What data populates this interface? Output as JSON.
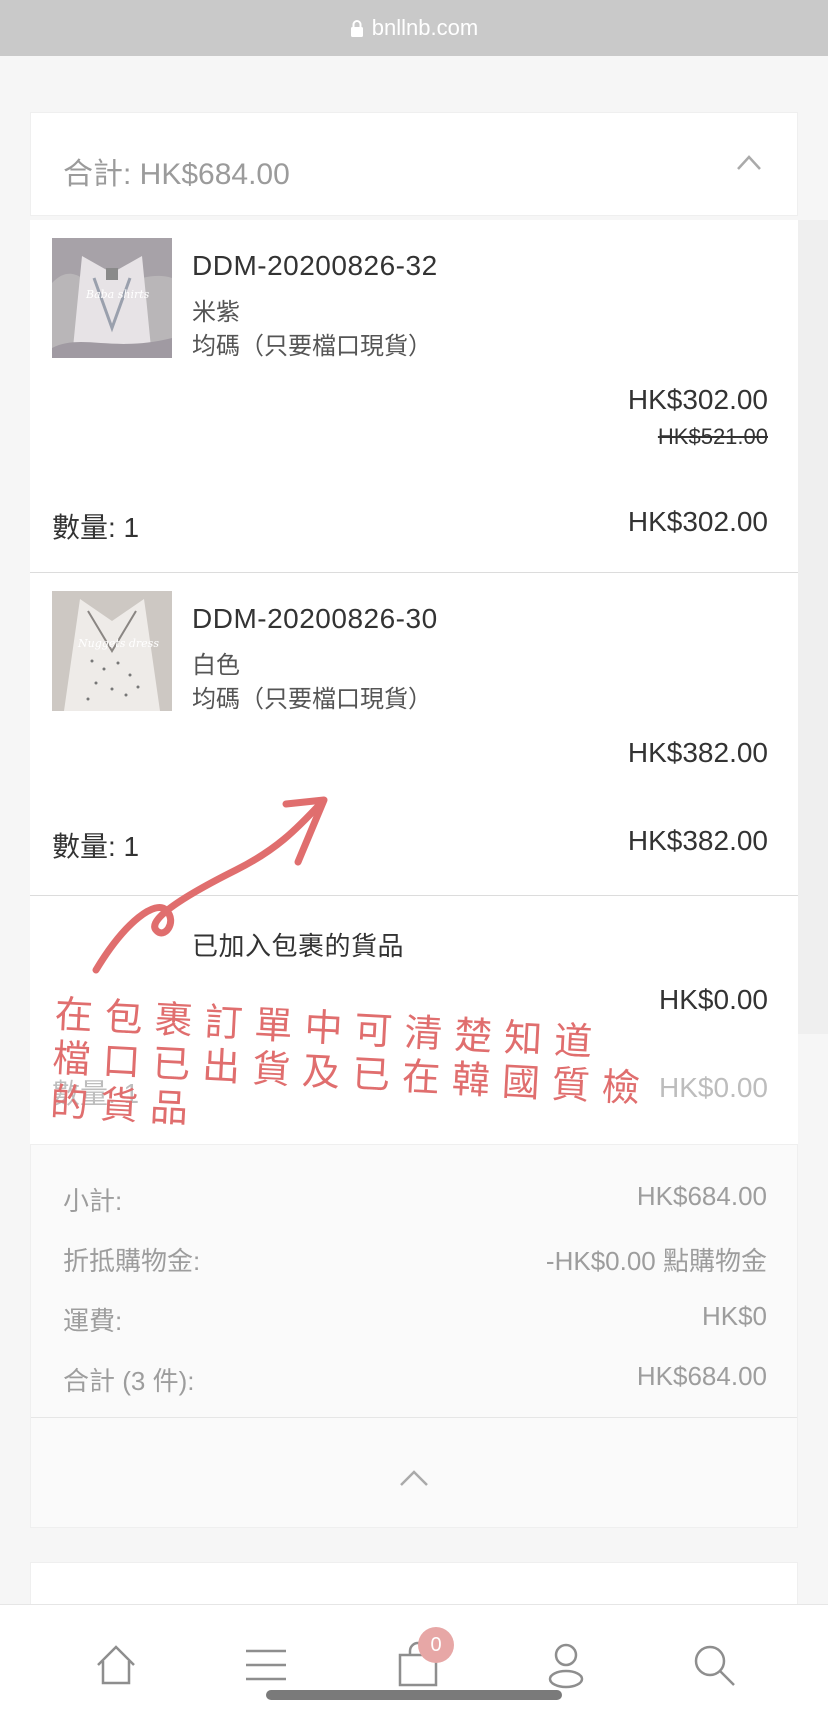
{
  "browser": {
    "url": "bnllnb.com"
  },
  "summary": {
    "title": "合計: HK$684.00"
  },
  "items": [
    {
      "sku": "DDM-20200826-32",
      "color": "米紫",
      "size": "均碼（只要檔口現貨）",
      "price": "HK$302.00",
      "original_price": "HK$521.00",
      "qty_label": "數量: 1",
      "line_total": "HK$302.00",
      "thumb_text": "Baba shirts"
    },
    {
      "sku": "DDM-20200826-30",
      "color": "白色",
      "size": "均碼（只要檔口現貨）",
      "price": "HK$382.00",
      "qty_label": "數量: 1",
      "line_total": "HK$382.00",
      "thumb_text": "Nuggets dress"
    }
  ],
  "package": {
    "title": "已加入包裹的貨品",
    "price": "HK$0.00",
    "qty_label": "數量: 1",
    "line_total": "HK$0.00"
  },
  "totals": {
    "subtotal_label": "小計:",
    "subtotal": "HK$684.00",
    "credit_label": "折抵購物金:",
    "credit": "-HK$0.00 點購物金",
    "shipping_label": "運費:",
    "shipping": "HK$0",
    "total_label": "合計 (3 件):",
    "total": "HK$684.00"
  },
  "annotation": {
    "lines": [
      "在包裹訂單中可清楚知道",
      "檔口已出貨及已在韓國質檢",
      "的貨品"
    ]
  },
  "nav": {
    "cart_count": "0"
  },
  "colors": {
    "annotation": "#e06e6e",
    "badge": "#e7a7a6"
  }
}
